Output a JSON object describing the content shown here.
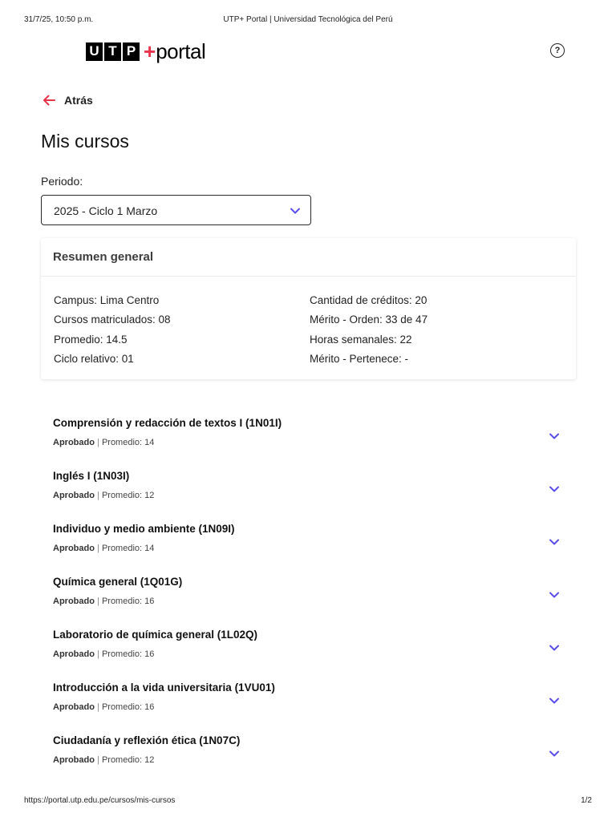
{
  "print_header": {
    "date": "31/7/25, 10:50 p.m.",
    "title": "UTP+ Portal | Universidad Tecnológica del Perú"
  },
  "print_footer": {
    "url": "https://portal.utp.edu.pe/cursos/mis-cursos",
    "page": "1/2"
  },
  "logo": {
    "letters": [
      "U",
      "T",
      "P"
    ],
    "plus": "+",
    "word": "portal"
  },
  "header": {
    "help_icon": "question-circle-icon",
    "help_glyph": "?"
  },
  "back": {
    "label": "Atrás",
    "icon": "arrow-left-icon"
  },
  "page_title": "Mis cursos",
  "period": {
    "label": "Periodo:",
    "value": "2025 - Ciclo 1 Marzo"
  },
  "summary": {
    "title": "Resumen general",
    "left": [
      "Campus: Lima Centro",
      "Cursos matriculados: 08",
      "Promedio: 14.5",
      "Ciclo relativo: 01"
    ],
    "right": [
      "Cantidad de créditos: 20",
      "Mérito - Orden: 33 de 47",
      "Horas semanales: 22",
      "Mérito - Pertenece: -"
    ]
  },
  "courses": [
    {
      "name": "Comprensión y redacción de textos I (1N01I)",
      "status": "Aprobado",
      "separator": "|",
      "avg": "Promedio: 14"
    },
    {
      "name": "Inglés I (1N03I)",
      "status": "Aprobado",
      "separator": "|",
      "avg": "Promedio: 12"
    },
    {
      "name": "Individuo y medio ambiente (1N09I)",
      "status": "Aprobado",
      "separator": "|",
      "avg": "Promedio: 14"
    },
    {
      "name": "Química general (1Q01G)",
      "status": "Aprobado",
      "separator": "|",
      "avg": "Promedio: 16"
    },
    {
      "name": "Laboratorio de química general (1L02Q)",
      "status": "Aprobado",
      "separator": "|",
      "avg": "Promedio: 16"
    },
    {
      "name": "Introducción a la vida universitaria (1VU01)",
      "status": "Aprobado",
      "separator": "|",
      "avg": "Promedio: 16"
    },
    {
      "name": "Ciudadanía y reflexión ética (1N07C)",
      "status": "Aprobado",
      "separator": "|",
      "avg": "Promedio: 12"
    }
  ],
  "colors": {
    "accent": "#5b4ee8",
    "brand_red": "#e8334a",
    "text": "#1c1c1c"
  }
}
